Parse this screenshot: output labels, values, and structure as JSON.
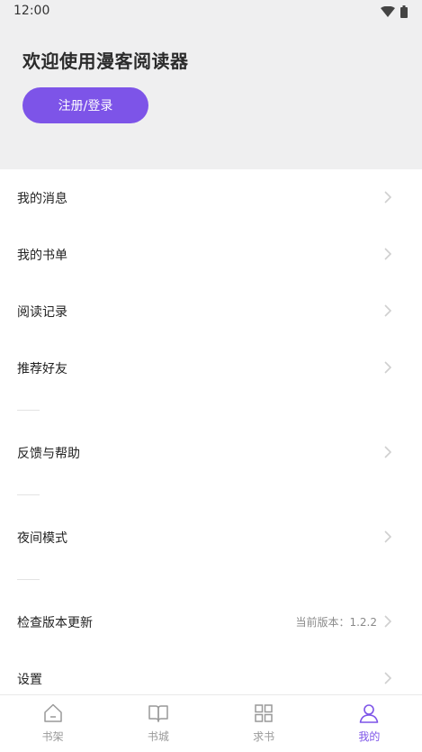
{
  "status_bar": {
    "time": "12:00"
  },
  "header": {
    "welcome_text": "欢迎使用漫客阅读器",
    "login_button": "注册/登录"
  },
  "menu": [
    {
      "label": "我的消息"
    },
    {
      "label": "我的书单"
    },
    {
      "label": "阅读记录"
    },
    {
      "label": "推荐好友"
    },
    {
      "label": "反馈与帮助"
    },
    {
      "label": "夜间模式"
    },
    {
      "label": "检查版本更新",
      "value": "当前版本：1.2.2"
    },
    {
      "label": "设置"
    }
  ],
  "bottom_nav": {
    "tabs": [
      {
        "label": "书架",
        "icon": "bookshelf-icon"
      },
      {
        "label": "书城",
        "icon": "book-open-icon"
      },
      {
        "label": "求书",
        "icon": "grid-icon"
      },
      {
        "label": "我的",
        "icon": "user-icon",
        "active": true
      }
    ]
  },
  "colors": {
    "accent": "#7d54e8",
    "header_bg": "#efeff0",
    "inactive": "#999999"
  }
}
